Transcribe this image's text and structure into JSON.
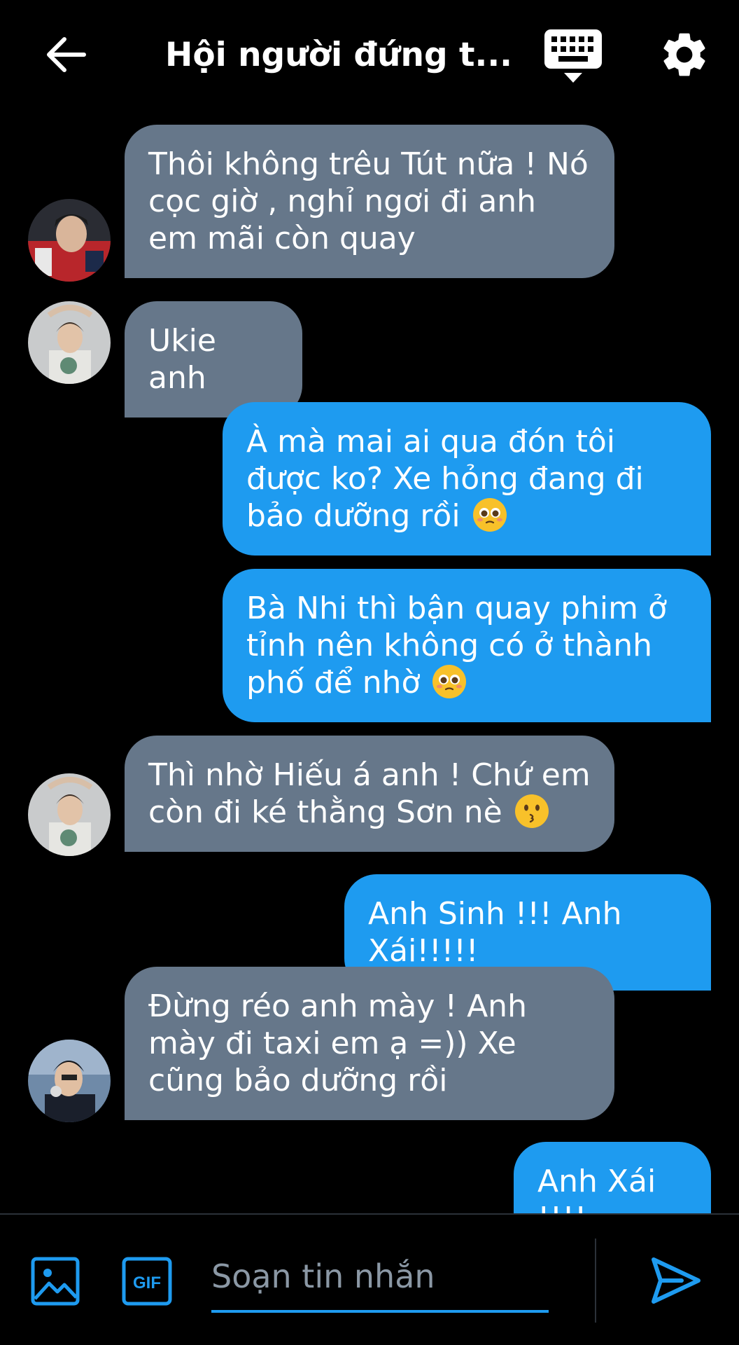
{
  "header": {
    "title": "Hội người đứng t..."
  },
  "messages": [
    {
      "direction": "in",
      "sender_avatar": "avatar-1",
      "text": "Thôi không trêu Tút nữa ! Nó cọc giờ , nghỉ ngơi đi anh em mãi còn quay"
    },
    {
      "direction": "in",
      "sender_avatar": "avatar-2",
      "text": "Ukie anh"
    },
    {
      "direction": "out",
      "text": "À mà mai ai qua đón tôi được ko? Xe hỏng đang đi bảo dưỡng rồi",
      "emoji": "pleading-face"
    },
    {
      "direction": "out",
      "text": "Bà Nhi thì bận quay phim ở tỉnh nên không có ở thành phố để nhờ",
      "emoji": "pleading-face"
    },
    {
      "direction": "in",
      "sender_avatar": "avatar-2",
      "text": "Thì nhờ Hiếu á anh ! Chứ em còn đi ké thằng Sơn nè",
      "emoji": "kissing-face"
    },
    {
      "direction": "out",
      "text": "Anh Sinh !!! Anh Xái!!!!!"
    },
    {
      "direction": "in",
      "sender_avatar": "avatar-3",
      "text": "Đừng réo anh mày ! Anh mày đi taxi em ạ =)) Xe cũng bảo dưỡng rồi"
    },
    {
      "direction": "out",
      "text": "Anh Xái !!!!"
    }
  ],
  "composer": {
    "placeholder": "Soạn tin nhắn",
    "gif_label": "GIF"
  },
  "colors": {
    "accent": "#1e9bf0",
    "incoming_bubble": "#66778a",
    "outgoing_bubble": "#1e9bf0",
    "background": "#000000"
  },
  "icons": {
    "back": "arrow-left-icon",
    "keyboard": "keyboard-icon",
    "settings": "gear-icon",
    "photo": "image-icon",
    "gif": "gif-icon",
    "send": "send-icon"
  }
}
